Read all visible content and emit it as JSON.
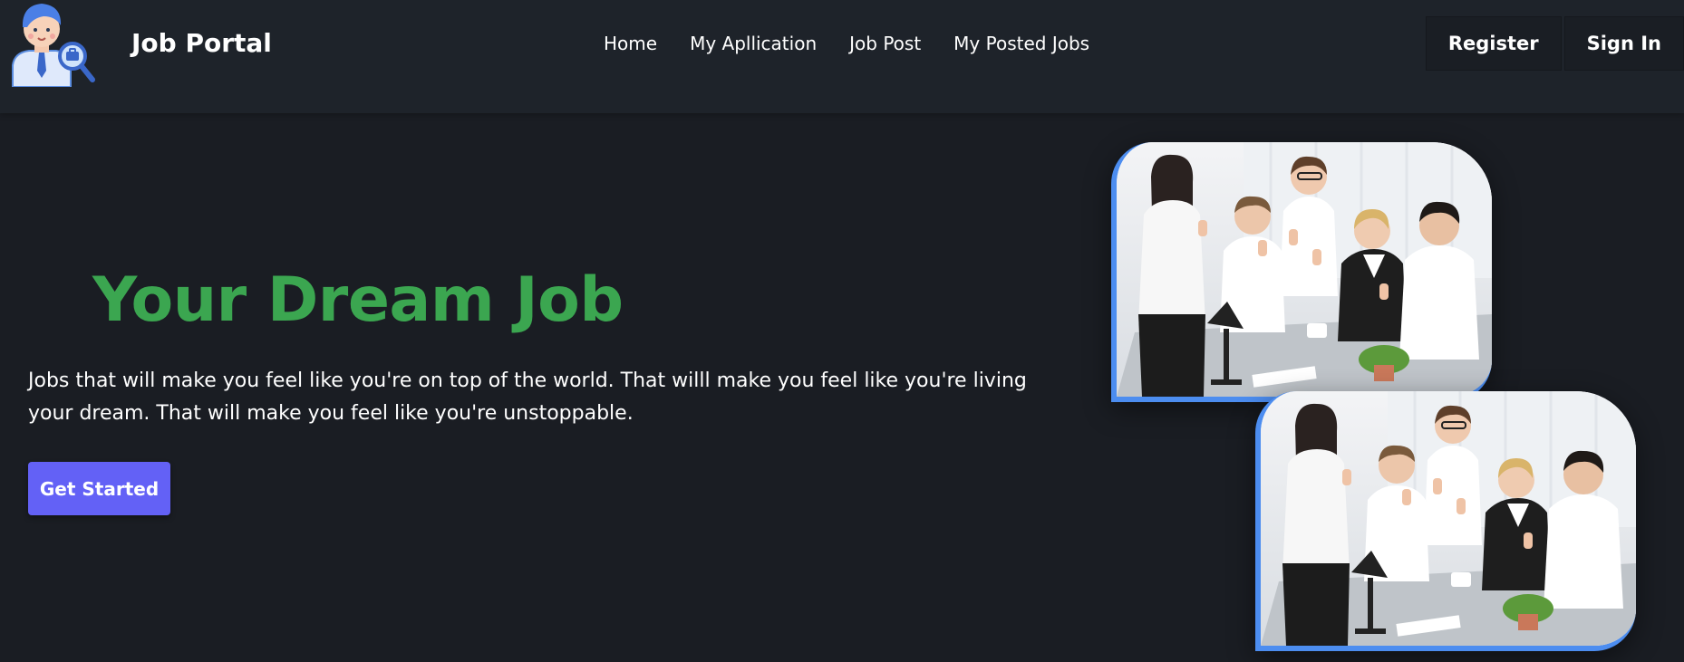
{
  "header": {
    "brand": "Job Portal",
    "logo_icon": "job-seeker-avatar-icon",
    "nav": [
      {
        "label": "Home"
      },
      {
        "label": "My Apllication"
      },
      {
        "label": "Job Post"
      },
      {
        "label": "My Posted Jobs"
      }
    ],
    "register_label": "Register",
    "signin_label": "Sign In"
  },
  "hero": {
    "title": "Your Dream Job",
    "description": "Jobs that will make you feel like you're on top of the world. That willl make you feel like you're living your dream. That will make you feel like you're unstoppable.",
    "cta_label": "Get Started",
    "image_alt": "Team of young professionals giving thumbs up at office desk"
  },
  "colors": {
    "background": "#1a1d23",
    "header_bg": "#1e232a",
    "title_green": "#3ba650",
    "cta_purple": "#6361f6",
    "photo_border_blue": "#4c8df0"
  }
}
